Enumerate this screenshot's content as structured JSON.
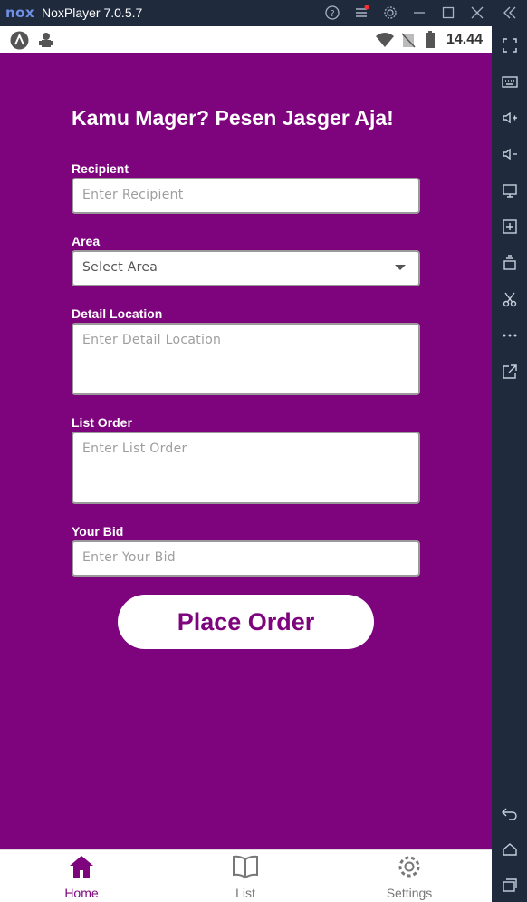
{
  "window": {
    "logo": "nox",
    "title": "NoxPlayer 7.0.5.7",
    "title_icons": [
      "help-icon",
      "menu-icon",
      "gear-icon",
      "minimize-icon",
      "maximize-icon",
      "close-icon",
      "collapse-sidebar-icon"
    ]
  },
  "status_bar": {
    "time": "14.44"
  },
  "app": {
    "title": "Kamu Mager? Pesen Jasger Aja!",
    "fields": {
      "recipient": {
        "label": "Recipient",
        "placeholder": "Enter Recipient"
      },
      "area": {
        "label": "Area",
        "value": "Select Area"
      },
      "detail_location": {
        "label": "Detail Location",
        "placeholder": "Enter Detail Location"
      },
      "list_order": {
        "label": "List Order",
        "placeholder": "Enter List Order"
      },
      "your_bid": {
        "label": "Your Bid",
        "placeholder": "Enter Your Bid"
      }
    },
    "submit_label": "Place Order"
  },
  "bottom_nav": {
    "items": [
      {
        "label": "Home",
        "icon": "home-icon",
        "active": true
      },
      {
        "label": "List",
        "icon": "book-icon",
        "active": false
      },
      {
        "label": "Settings",
        "icon": "gear-icon",
        "active": false
      }
    ]
  },
  "colors": {
    "brand": "#7d047d",
    "nav_inactive": "#777777",
    "frame": "#1f2a3c"
  }
}
